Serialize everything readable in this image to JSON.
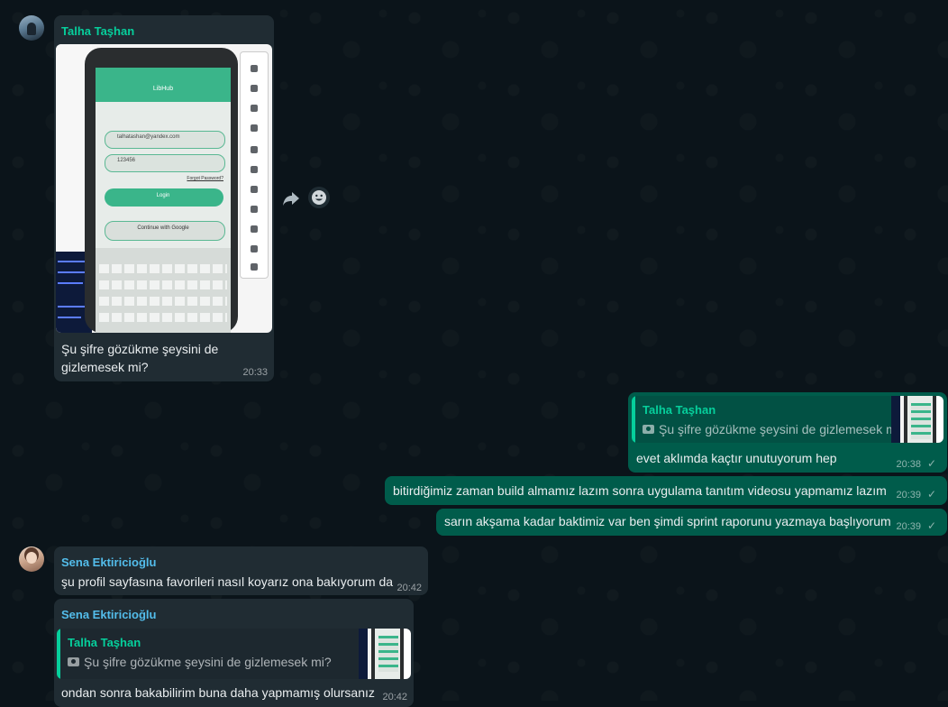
{
  "messages": {
    "m1": {
      "sender": "Talha Taşhan",
      "text_line1": "Şu şifre gözükme şeysini de",
      "text_line2": "gizlemesek mi?",
      "time": "20:33",
      "photo_app_title": "LibHub",
      "photo_email": "talhatashan@yandex.com",
      "photo_password": "123456",
      "photo_forgot": "Forgot Password?",
      "photo_login": "Login",
      "photo_google": "Continue with Google"
    },
    "m2": {
      "quote_name": "Talha Taşhan",
      "quote_text": "Şu şifre gözükme şeysini de gizlemesek mi?",
      "text": "evet aklımda kaçtır unutuyorum hep",
      "time": "20:38",
      "status_icon": "check-icon"
    },
    "m3": {
      "text": "bitirdiğimiz zaman build almamız lazım sonra uygulama tanıtım videosu yapmamız lazım",
      "time": "20:39",
      "status_icon": "check-icon"
    },
    "m4": {
      "text": "sarın akşama kadar baktimiz var ben şimdi sprint raporunu yazmaya başlıyorum",
      "time": "20:39",
      "status_icon": "check-icon"
    },
    "m5": {
      "sender": "Sena Ektiricioğlu",
      "text": "şu profil sayfasına favorileri nasıl koyarız ona bakıyorum da",
      "time": "20:42"
    },
    "m6": {
      "sender": "Sena Ektiricioğlu",
      "quote_name": "Talha Taşhan",
      "quote_text": "Şu şifre gözükme şeysini de gizlemesek mi?",
      "text": "ondan sonra bakabilirim buna daha yapmamış olursanız",
      "time": "20:42"
    }
  },
  "icons": {
    "forward": "forward-icon",
    "react": "emoji-icon",
    "camera": "camera-icon"
  },
  "colors": {
    "background": "#0b141a",
    "incoming_bubble": "#202c33",
    "outgoing_bubble": "#005c4b",
    "talha_name": "#06cf9c",
    "sena_name": "#53bdeb"
  }
}
